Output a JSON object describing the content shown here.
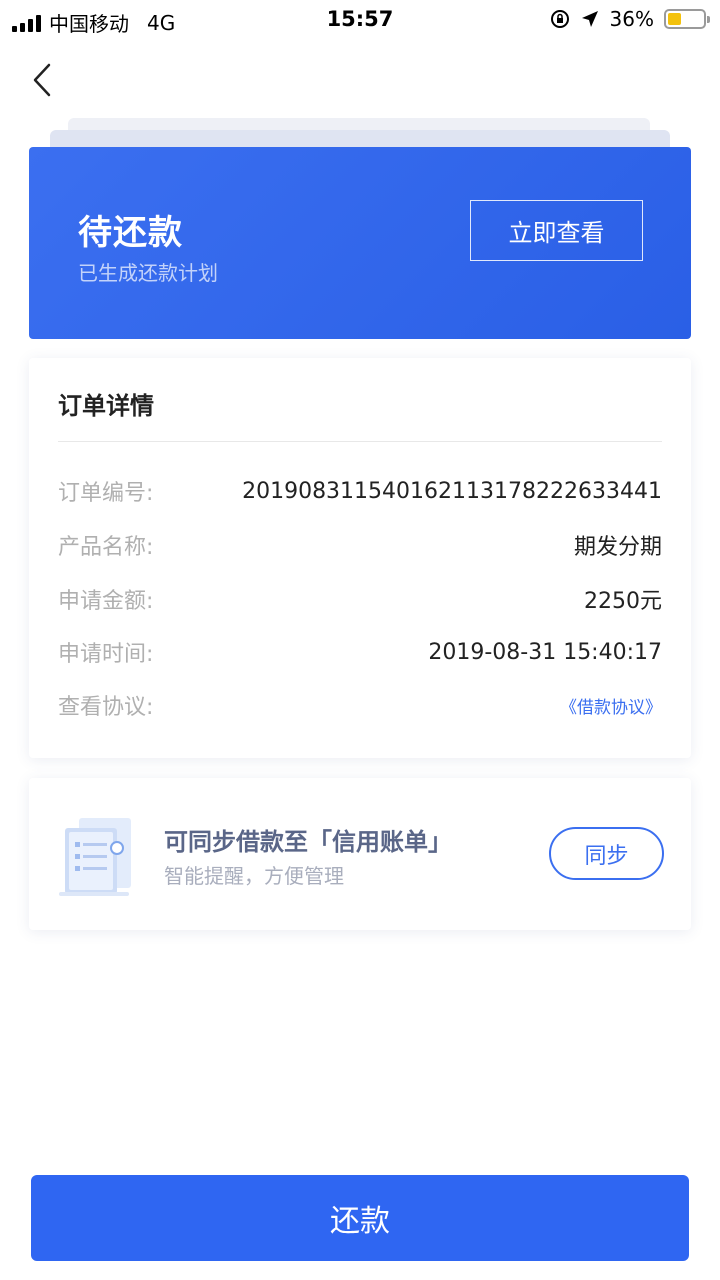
{
  "status_bar": {
    "carrier": "中国移动",
    "network": "4G",
    "time": "15:57",
    "battery": "36%"
  },
  "status_card": {
    "title": "待还款",
    "subtitle": "已生成还款计划",
    "view_button": "立即查看"
  },
  "order": {
    "title": "订单详情",
    "rows": [
      {
        "label": "订单编号:",
        "value": "2019083115401621131782226334 41"
      },
      {
        "label": "产品名称:",
        "value": "期发分期"
      },
      {
        "label": "申请金额:",
        "value": "2250元"
      },
      {
        "label": "申请时间:",
        "value": "2019-08-31 15:40:17"
      },
      {
        "label": "查看协议:",
        "value": "《借款协议》"
      }
    ]
  },
  "sync": {
    "title": "可同步借款至「信用账单」",
    "subtitle": "智能提醒，方便管理",
    "button": "同步"
  },
  "repay_button": "还款",
  "colors": {
    "primary": "#2f66f2",
    "card_blue": "#3b6ff0",
    "battery": "#f4c20d"
  }
}
